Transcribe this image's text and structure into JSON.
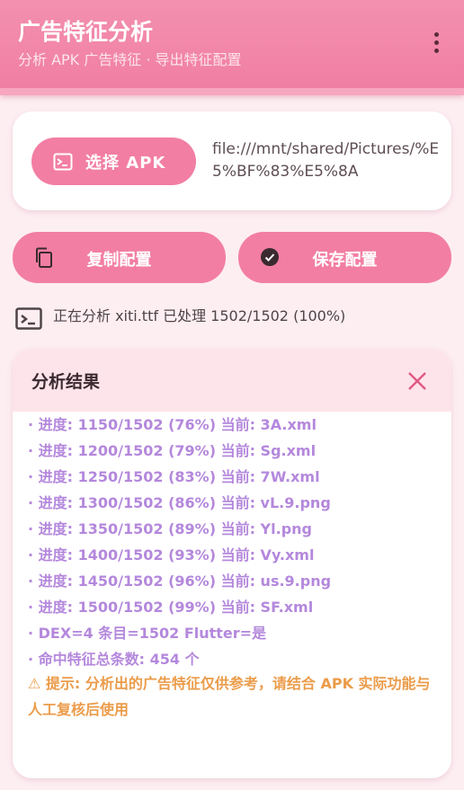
{
  "header": {
    "title": "广告特征分析",
    "subtitle": "分析 APK 广告特征 · 导出特征配置",
    "more_icon": "more-vert-icon"
  },
  "source": {
    "select_button_label": "选择 APK",
    "select_icon": "terminal-icon",
    "path": "file:///mnt/shared/Pictures/%E5%BF%83%E5%8A"
  },
  "actions": {
    "copy_label": "复制配置",
    "copy_icon": "copy-icon",
    "save_label": "保存配置",
    "save_icon": "check-circle-icon"
  },
  "status": {
    "icon": "terminal-icon",
    "text": "正在分析 xiti.ttf 已处理 1502/1502 (100%)"
  },
  "results": {
    "title": "分析结果",
    "close_icon": "close-icon",
    "log": [
      "· 进度: 1150/1502 (76%) 当前: 3A.xml",
      "· 进度: 1200/1502 (79%) 当前: Sg.xml",
      "· 进度: 1250/1502 (83%) 当前: 7W.xml",
      "· 进度: 1300/1502 (86%) 当前: vL.9.png",
      "· 进度: 1350/1502 (89%) 当前: Yl.png",
      "· 进度: 1400/1502 (93%) 当前: Vy.xml",
      "· 进度: 1450/1502 (96%) 当前: us.9.png",
      "· 进度: 1500/1502 (99%) 当前: SF.xml",
      "· DEX=4 条目=1502 Flutter=是",
      "· 命中特征总条数: 454 个"
    ],
    "warning": "⚠ 提示: 分析出的广告特征仅供参考，请结合 APK 实际功能与人工复核后使用"
  },
  "colors": {
    "primary": "#f27ea3",
    "background": "#fdeef2",
    "log_text": "#b488dc",
    "warning_text": "#eb9c4a",
    "close_icon": "#e05a85"
  }
}
